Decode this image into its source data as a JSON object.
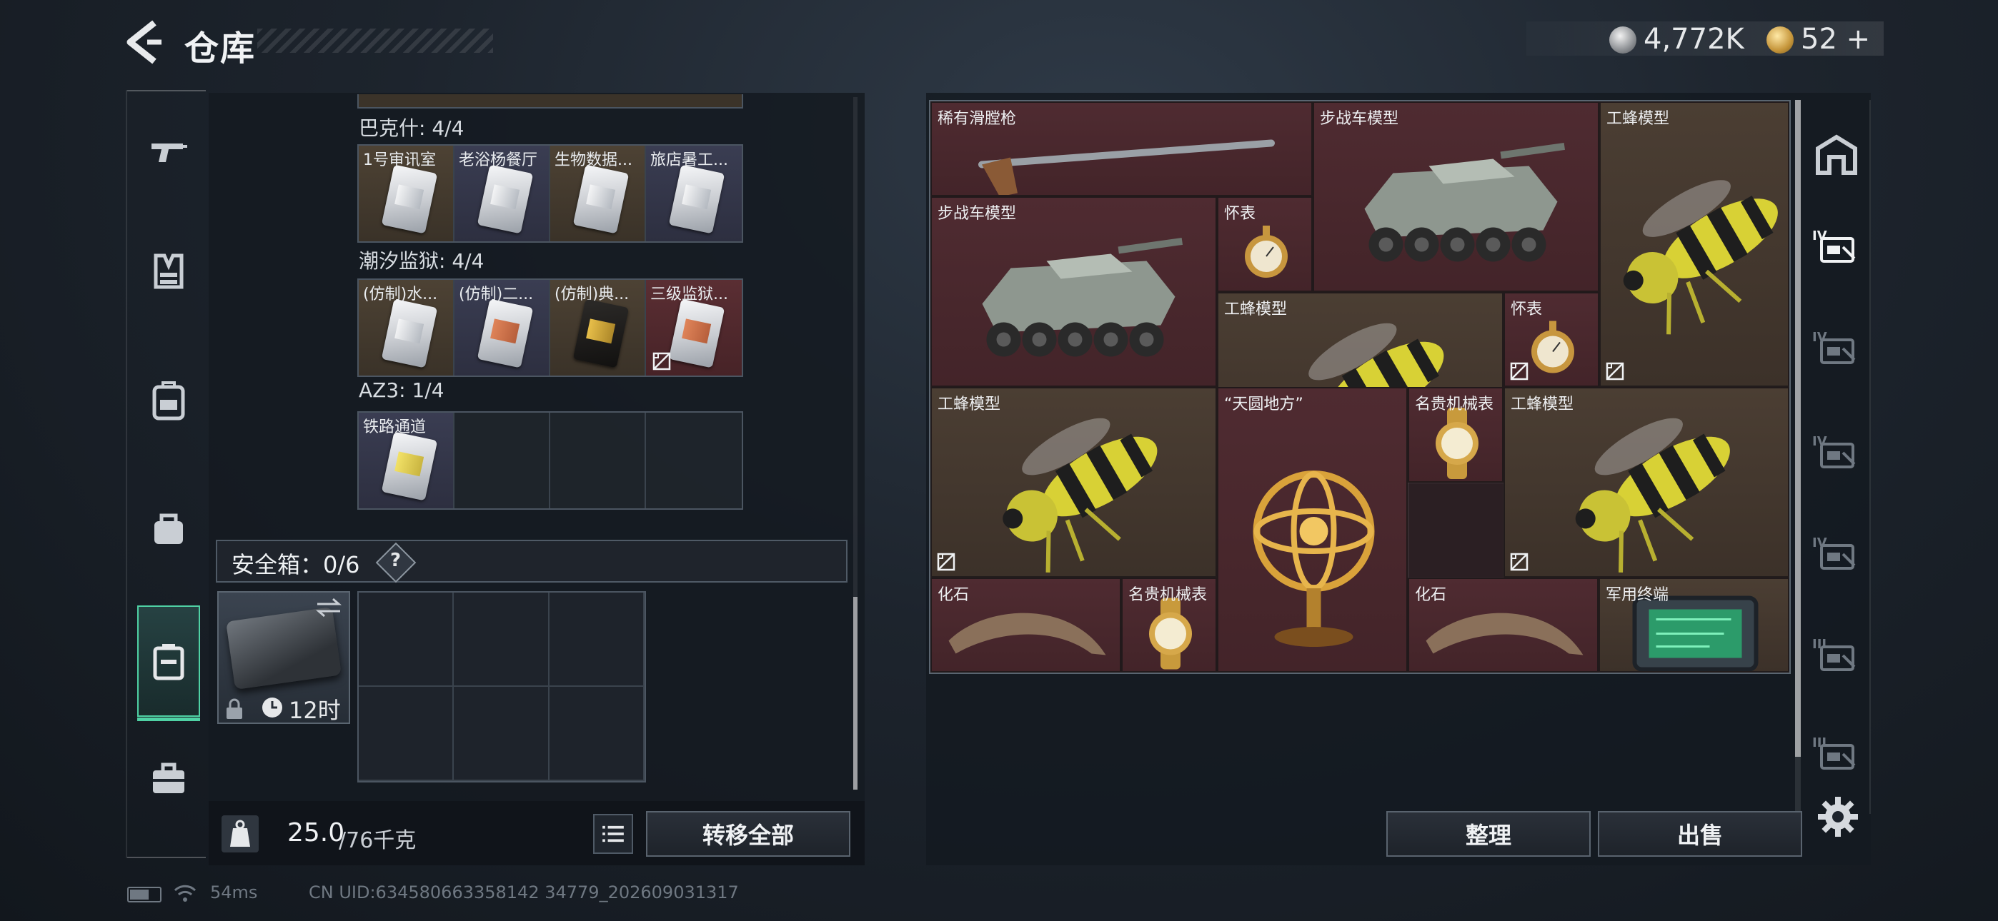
{
  "header": {
    "title": "仓库"
  },
  "currency": {
    "silver": "4,772K",
    "gold": "52",
    "gold_add": "+"
  },
  "left_nav": [
    "weapon-icon",
    "armor-icon",
    "backpack-icon",
    "bag-icon",
    "secure-case-icon",
    "toolbox-icon"
  ],
  "groups": [
    {
      "label": "巴克什: 4/4",
      "items": [
        {
          "name": "1号审讯室",
          "bg": "gold",
          "card": ""
        },
        {
          "name": "老浴杨餐厅",
          "bg": "blue",
          "card": ""
        },
        {
          "name": "生物数据...",
          "bg": "gold",
          "card": ""
        },
        {
          "name": "旅店暑工...",
          "bg": "blue",
          "card": ""
        }
      ]
    },
    {
      "label": "潮汐监狱: 4/4",
      "items": [
        {
          "name": "(仿制)水...",
          "bg": "gold",
          "card": ""
        },
        {
          "name": "(仿制)二...",
          "bg": "blue",
          "card": "org"
        },
        {
          "name": "(仿制)典...",
          "bg": "gold",
          "card": "blk"
        },
        {
          "name": "三级监狱...",
          "bg": "red",
          "card": "org"
        }
      ]
    },
    {
      "label": "AZ3: 1/4",
      "items": [
        {
          "name": "铁路通道",
          "bg": "blue",
          "card": "ylw"
        }
      ]
    }
  ],
  "secure": {
    "label": "安全箱：0/6",
    "help": "?",
    "time": "12时"
  },
  "weight": {
    "current": "25.0",
    "max": "/76千克"
  },
  "buttons": {
    "transfer_all": "转移全部",
    "sort": "整理",
    "sell": "出售"
  },
  "stash_items": [
    {
      "name": "稀有滑膛枪",
      "color": "red",
      "art": "musket"
    },
    {
      "name": "步战车模型",
      "color": "red",
      "art": "ifv"
    },
    {
      "name": "工蜂模型",
      "color": "gold",
      "art": "bee"
    },
    {
      "name": "步战车模型",
      "color": "red",
      "art": "ifv"
    },
    {
      "name": "怀表",
      "color": "red",
      "art": "watch"
    },
    {
      "name": "工蜂模型",
      "color": "gold",
      "art": "bee"
    },
    {
      "name": "怀表",
      "color": "red",
      "art": "watch"
    },
    {
      "name": "工蜂模型",
      "color": "gold",
      "art": "bee"
    },
    {
      "name": "“天圆地方”",
      "color": "red",
      "art": "globe"
    },
    {
      "name": "名贵机械表",
      "color": "red",
      "art": "wristwatch"
    },
    {
      "name": "工蜂模型",
      "color": "gold",
      "art": "bee"
    },
    {
      "name": "化石",
      "color": "red",
      "art": "fossil"
    },
    {
      "name": "名贵机械表",
      "color": "red",
      "art": "wristwatch"
    },
    {
      "name": "化石",
      "color": "red",
      "art": "fossil"
    },
    {
      "name": "军用终端",
      "color": "gold",
      "art": "terminal"
    }
  ],
  "right_nav": [
    {
      "icon": "base-icon",
      "roman": ""
    },
    {
      "icon": "keycard-tier-4-icon",
      "roman": "IV"
    },
    {
      "icon": "keycard-tier-4-icon",
      "roman": "IV"
    },
    {
      "icon": "keycard-tier-4-icon",
      "roman": "IV"
    },
    {
      "icon": "document-tier-4-icon",
      "roman": "IV"
    },
    {
      "icon": "keycard-tier-3-icon",
      "roman": "III"
    },
    {
      "icon": "keycard-tier-3-icon",
      "roman": "III"
    }
  ],
  "status": {
    "ping": "54ms",
    "uid": "CN UID:634580663358142 34779_202609031317"
  }
}
